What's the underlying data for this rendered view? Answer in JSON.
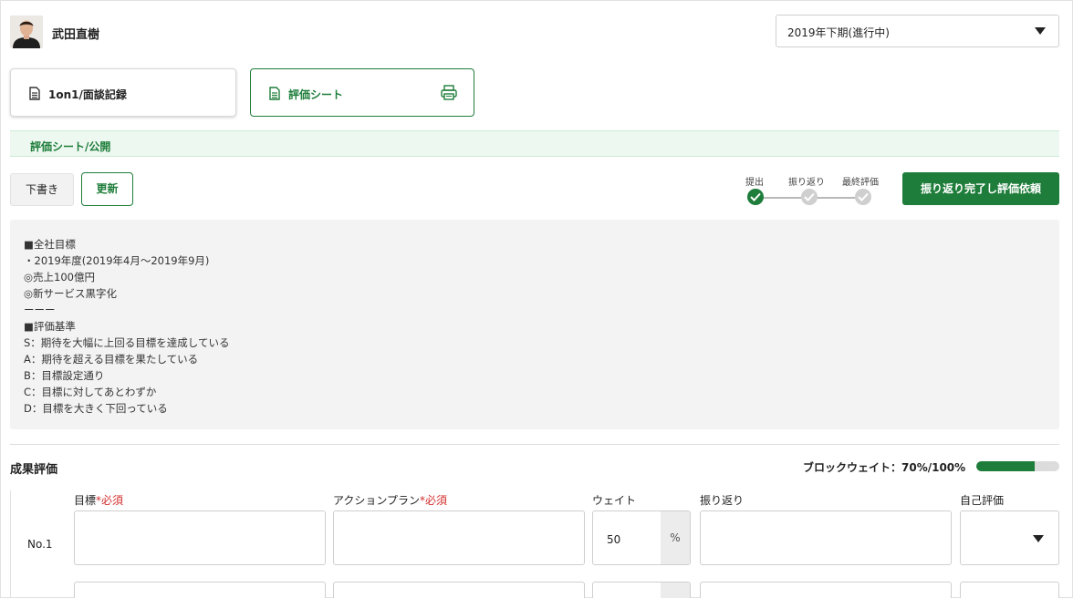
{
  "header": {
    "user_name": "武田直樹",
    "period": "2019年下期(進行中)"
  },
  "tabs": [
    {
      "label": "1on1/面談記録"
    },
    {
      "label": "評価シート"
    }
  ],
  "section": {
    "title": "評価シート/公開"
  },
  "actions": {
    "draft_label": "下書き",
    "update_label": "更新",
    "complete_label": "振り返り完了し評価依頼"
  },
  "steps": [
    {
      "label": "提出",
      "status": "done"
    },
    {
      "label": "振り返り",
      "status": "todo"
    },
    {
      "label": "最終評価",
      "status": "todo"
    }
  ],
  "guidelines": [
    "■全社目標",
    "・2019年度(2019年4月～2019年9月)",
    "◎売上100億円",
    "◎新サービス黒字化",
    "ーーー",
    "■評価基準",
    "S：期待を大幅に上回る目標を達成している",
    "A：期待を超える目標を果たしている",
    "B：目標設定通り",
    "C：目標に対してあとわずか",
    "D：目標を大きく下回っている"
  ],
  "performance": {
    "title": "成果評価",
    "block_weight_label": "ブロックウェイト：70%/100%",
    "block_weight_fraction": 0.7,
    "columns": {
      "goal": "目標",
      "action_plan": "アクションプラン",
      "required_mark": "*必須",
      "weight": "ウェイト",
      "reflection": "振り返り",
      "self_eval": "自己評価"
    },
    "rows": [
      {
        "label": "No.1",
        "weight": "50",
        "unit": "%"
      }
    ]
  },
  "colors": {
    "accent": "#1e7d3a",
    "section_bg": "#edf8f0",
    "required": "#d32f2f"
  },
  "icons": [
    "document-icon",
    "printer-icon",
    "check-icon",
    "dropdown-arrow-icon"
  ]
}
